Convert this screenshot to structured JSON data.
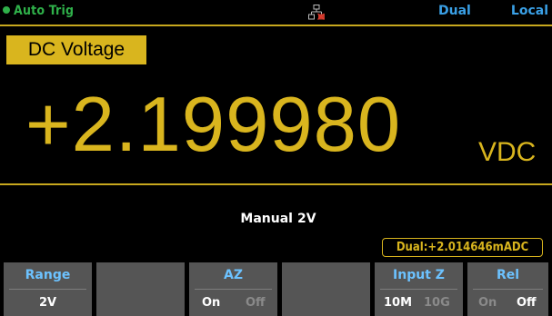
{
  "status": {
    "trigger": "Auto Trig",
    "dual": "Dual",
    "local": "Local",
    "network_icon": "lan-icon"
  },
  "function_tab": "DC Voltage",
  "reading": {
    "value": "+2.199980",
    "unit": "VDC"
  },
  "range_info": {
    "mode": "Manual",
    "range": "2V"
  },
  "dual_display": "Dual:+2.014646mADC",
  "softkeys": {
    "range": {
      "label": "Range",
      "value": "2V"
    },
    "az": {
      "label": "AZ",
      "opt_a": "On",
      "opt_b": "Off",
      "selected": "On"
    },
    "input_z": {
      "label": "Input Z",
      "opt_a": "10M",
      "opt_b": "10G",
      "selected": "10M"
    },
    "rel": {
      "label": "Rel",
      "opt_a": "On",
      "opt_b": "Off",
      "selected": "Off"
    }
  },
  "colors": {
    "accent_yellow": "#d9b51e",
    "status_green": "#2fb14a",
    "status_blue": "#3aa0e6",
    "softkey_label": "#6cc2ff",
    "softkey_bg": "#555555"
  }
}
